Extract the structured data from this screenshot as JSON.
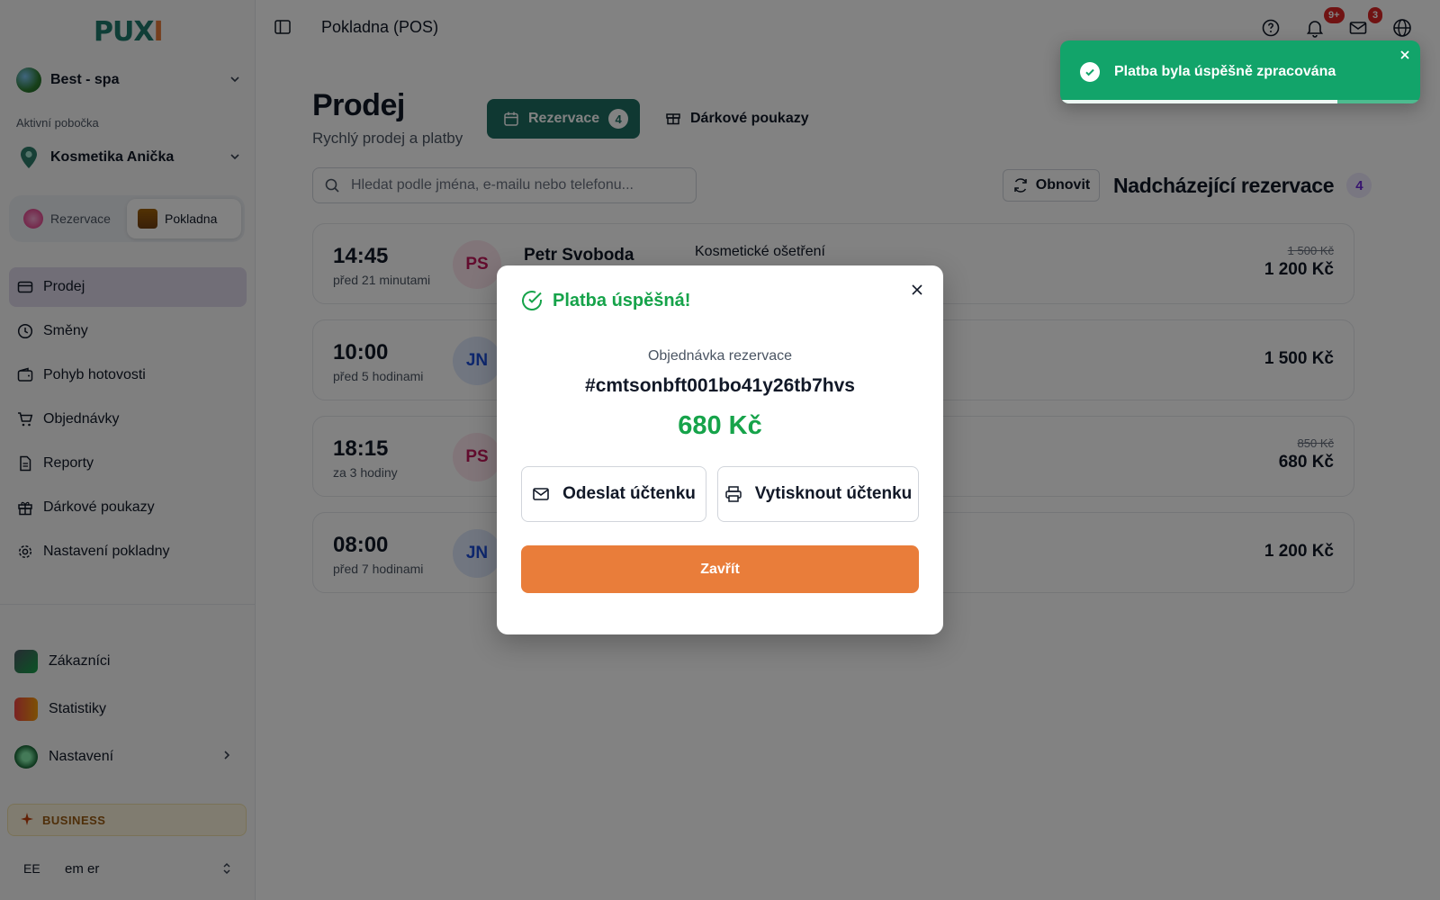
{
  "app": {
    "logo_main": "PUX",
    "logo_accent": "I",
    "page_title": "Pokladna (POS)"
  },
  "sidebar": {
    "business_name": "Best - spa",
    "branch_label": "Aktivní pobočka",
    "branch_name": "Kosmetika Anička",
    "modes": [
      {
        "label": "Rezervace",
        "active": false
      },
      {
        "label": "Pokladna",
        "active": true
      }
    ],
    "nav": [
      {
        "label": "Prodej",
        "icon": "credit-card-icon",
        "active": true
      },
      {
        "label": "Směny",
        "icon": "clock-icon"
      },
      {
        "label": "Pohyb hotovosti",
        "icon": "wallet-icon"
      },
      {
        "label": "Objednávky",
        "icon": "cart-icon"
      },
      {
        "label": "Reporty",
        "icon": "file-icon"
      },
      {
        "label": "Dárkové poukazy",
        "icon": "gift-icon"
      },
      {
        "label": "Nastavení pokladny",
        "icon": "gear-icon"
      }
    ],
    "nav2": [
      {
        "label": "Zákazníci",
        "icon": "customers-icon"
      },
      {
        "label": "Statistiky",
        "icon": "stats-icon"
      },
      {
        "label": "Nastavení",
        "icon": "settings-icon"
      }
    ],
    "plan": "BUSINESS",
    "user_initials": "EE",
    "user_name": "em er"
  },
  "topbar": {
    "notifications_badge": "9+",
    "messages_badge": "3"
  },
  "main": {
    "title": "Prodej",
    "subtitle": "Rychlý prodej a platby",
    "tab_reservations": "Rezervace",
    "tab_reservations_count": "4",
    "tab_gift": "Dárkové poukazy",
    "search_placeholder": "Hledat podle jména, e-mailu nebo telefonu...",
    "refresh_label": "Obnovit",
    "upcoming_label": "Nadcházející rezervace",
    "upcoming_count": "4",
    "reservations": [
      {
        "time": "14:45",
        "relative": "před 21 minutami",
        "initials": "PS",
        "name": "Petr Svoboda",
        "service": "Kosmetické ošetření",
        "old_price": "1 500 Kč",
        "price": "1 200 Kč",
        "avatar_bg": "#fde6ee",
        "avatar_fg": "#c2185b"
      },
      {
        "time": "10:00",
        "relative": "před 5 hodinami",
        "initials": "JN",
        "name": "",
        "service": "",
        "old_price": "",
        "price": "1 500 Kč",
        "avatar_bg": "#dde7fb",
        "avatar_fg": "#1d4ed8"
      },
      {
        "time": "18:15",
        "relative": "za 3 hodiny",
        "initials": "PS",
        "name": "",
        "service": "",
        "old_price": "850 Kč",
        "price": "680 Kč",
        "avatar_bg": "#fde6ee",
        "avatar_fg": "#c2185b"
      },
      {
        "time": "08:00",
        "relative": "před 7 hodinami",
        "initials": "JN",
        "name": "",
        "service": "",
        "old_price": "",
        "price": "1 200 Kč",
        "avatar_bg": "#dde7fb",
        "avatar_fg": "#1d4ed8"
      }
    ]
  },
  "modal": {
    "title": "Platba úspěšná!",
    "order_label": "Objednávka rezervace",
    "order_id": "#cmtsonbft001bo41y26tb7hvs",
    "amount": "680 Kč",
    "send_receipt": "Odeslat účtenku",
    "print_receipt": "Vytisknout účtenku",
    "close_label": "Zavřít"
  },
  "toast": {
    "message": "Platba byla úspěšně zpracována",
    "progress_percent": 77
  },
  "colors": {
    "brand": "#1f6e62",
    "accent": "#e97d3a",
    "success": "#16a34a",
    "toast": "#12a46a"
  }
}
